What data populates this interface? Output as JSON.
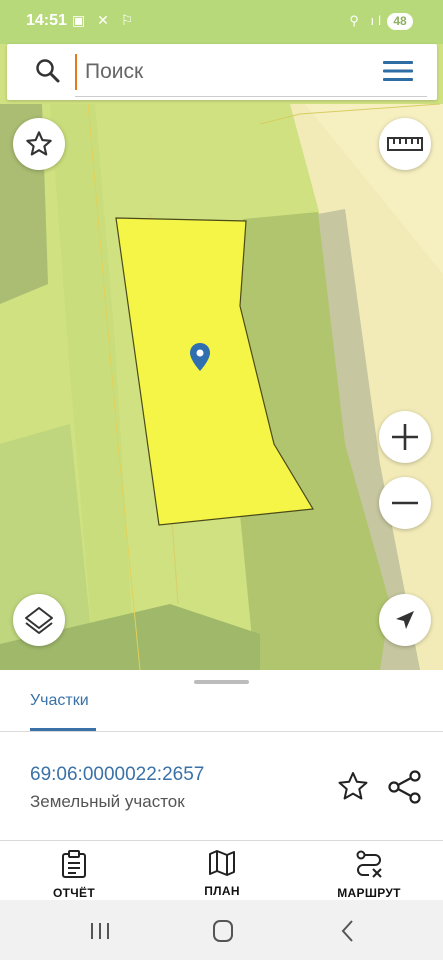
{
  "status_bar": {
    "time": "14:51",
    "left_icons": "▣ ✕ ⚐",
    "right_icons": "⚲ ıl",
    "battery": "48"
  },
  "search": {
    "placeholder": "Поиск",
    "icon": "search-icon",
    "menu_icon": "hamburger-menu-icon"
  },
  "map": {
    "parcel_color": "#f5f547",
    "marker_color": "#2f6fb0",
    "buttons": {
      "favorite": "star-icon",
      "ruler": "ruler-icon",
      "zoom_in": "plus-icon",
      "zoom_out": "minus-icon",
      "layers": "layers-icon",
      "location": "navigation-arrow-icon"
    }
  },
  "sheet": {
    "tab": "Участки",
    "parcel": {
      "number": "69:06:0000022:2657",
      "type": "Земельный участок"
    },
    "actions": [
      {
        "label": "ОТЧЁТ",
        "icon": "clipboard-icon"
      },
      {
        "label": "ПЛАН",
        "icon": "map-icon"
      },
      {
        "label": "МАРШРУТ",
        "icon": "route-icon"
      }
    ]
  },
  "colors": {
    "accent": "#3a72a8",
    "status_bar": "#b7d97a"
  }
}
